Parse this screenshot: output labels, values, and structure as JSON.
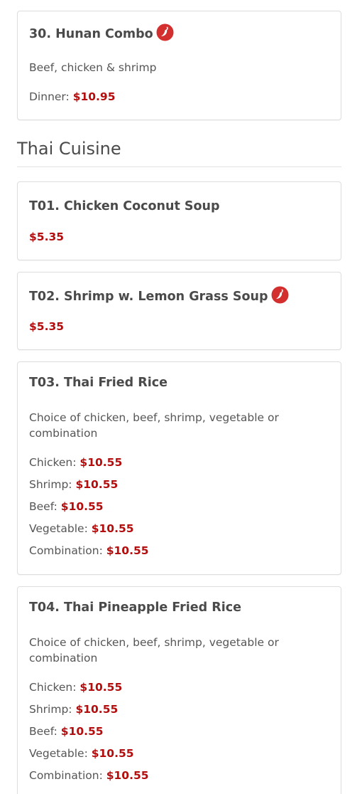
{
  "colors": {
    "price": "#b30d0d",
    "hot_icon": "#d32f2f"
  },
  "card30": {
    "title": "30. Hunan Combo",
    "desc": "Beef, chicken & shrimp",
    "dinner_label": "Dinner:",
    "dinner_price": "$10.95"
  },
  "section": {
    "title": "Thai Cuisine"
  },
  "t01": {
    "title": "T01. Chicken Coconut Soup",
    "price": "$5.35"
  },
  "t02": {
    "title": "T02. Shrimp w. Lemon Grass Soup",
    "price": "$5.35"
  },
  "t03": {
    "title": "T03. Thai Fried Rice",
    "desc": "Choice of chicken, beef, shrimp, vegetable or combination",
    "options": [
      {
        "label": "Chicken:",
        "price": "$10.55"
      },
      {
        "label": "Shrimp:",
        "price": "$10.55"
      },
      {
        "label": "Beef:",
        "price": "$10.55"
      },
      {
        "label": "Vegetable:",
        "price": "$10.55"
      },
      {
        "label": "Combination:",
        "price": "$10.55"
      }
    ]
  },
  "t04": {
    "title": "T04. Thai Pineapple Fried Rice",
    "desc": "Choice of chicken, beef, shrimp, vegetable or combination",
    "options": [
      {
        "label": "Chicken:",
        "price": "$10.55"
      },
      {
        "label": "Shrimp:",
        "price": "$10.55"
      },
      {
        "label": "Beef:",
        "price": "$10.55"
      },
      {
        "label": "Vegetable:",
        "price": "$10.55"
      },
      {
        "label": "Combination:",
        "price": "$10.55"
      }
    ]
  }
}
